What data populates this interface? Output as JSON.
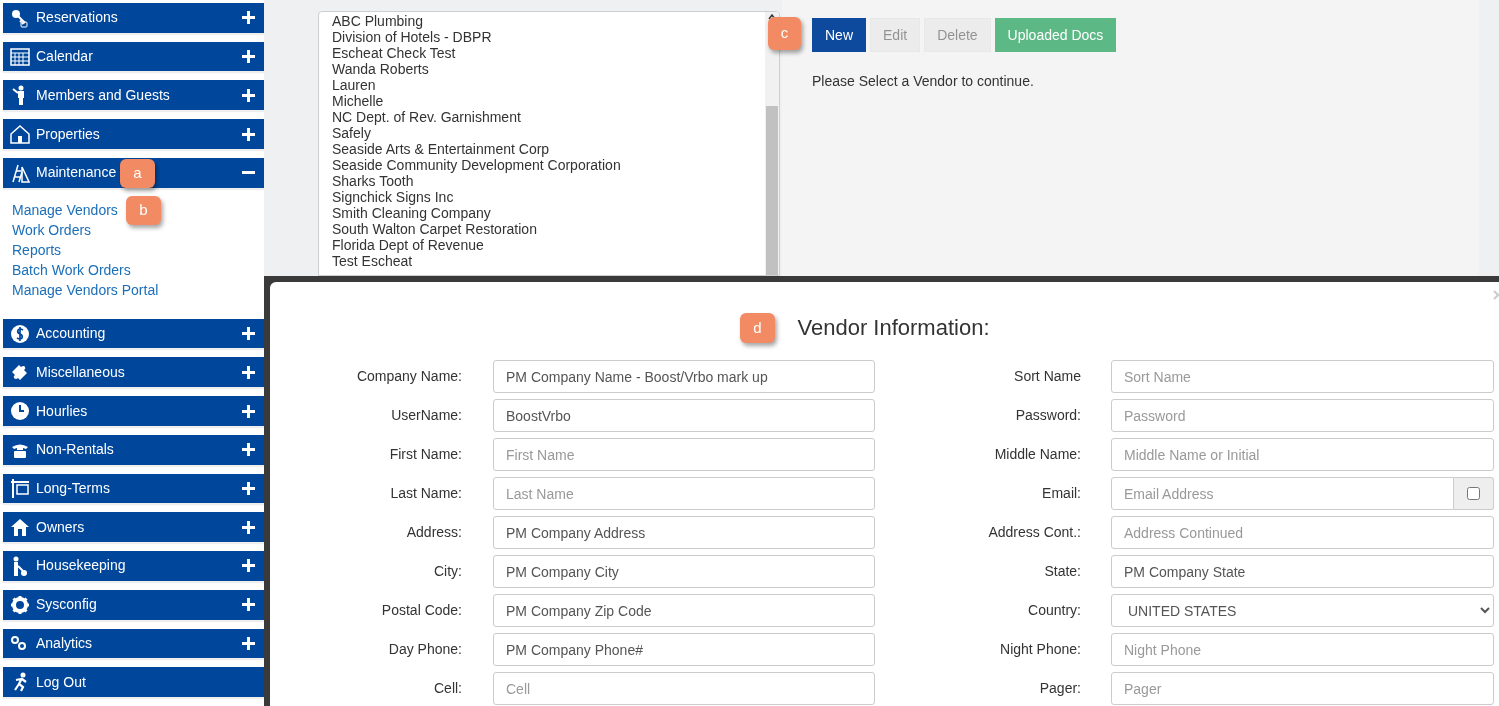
{
  "sidebar": {
    "sections": [
      {
        "label": "Reservations",
        "kind": "section",
        "expanded": false
      },
      {
        "label": "Calendar",
        "kind": "section",
        "expanded": false
      },
      {
        "label": "Members and Guests",
        "kind": "section",
        "expanded": false
      },
      {
        "label": "Properties",
        "kind": "section",
        "expanded": false
      },
      {
        "label": "Maintenance",
        "kind": "section",
        "expanded": true,
        "children": [
          {
            "label": "Manage Vendors"
          },
          {
            "label": "Work Orders"
          },
          {
            "label": "Reports"
          },
          {
            "label": "Batch Work Orders"
          },
          {
            "label": "Manage Vendors Portal"
          }
        ]
      },
      {
        "label": "Accounting",
        "kind": "section",
        "expanded": false
      },
      {
        "label": "Miscellaneous",
        "kind": "section",
        "expanded": false
      },
      {
        "label": "Hourlies",
        "kind": "section",
        "expanded": false
      },
      {
        "label": "Non-Rentals",
        "kind": "section",
        "expanded": false
      },
      {
        "label": "Long-Terms",
        "kind": "section",
        "expanded": false
      },
      {
        "label": "Owners",
        "kind": "section",
        "expanded": false
      },
      {
        "label": "Housekeeping",
        "kind": "section",
        "expanded": false
      },
      {
        "label": "Sysconfig",
        "kind": "section",
        "expanded": false
      },
      {
        "label": "Analytics",
        "kind": "section",
        "expanded": false
      },
      {
        "label": "Log Out",
        "kind": "link"
      }
    ]
  },
  "vendor_list": {
    "items": [
      "ABC Plumbing",
      "Division of Hotels - DBPR",
      "Escheat Check Test",
      "Wanda Roberts",
      "Lauren",
      "Michelle",
      "NC Dept. of Rev. Garnishment",
      "Safely",
      "Seaside Arts & Entertainment Corp",
      "Seaside Community Development Corporation",
      "Sharks Tooth",
      "Signchick Signs Inc",
      "Smith Cleaning Company",
      "South Walton Carpet Restoration",
      "Florida Dept of Revenue",
      "Test Escheat"
    ]
  },
  "toolbar": [
    {
      "label": "New",
      "kind": "primary",
      "disabled": false
    },
    {
      "label": "Edit",
      "kind": "default",
      "disabled": true
    },
    {
      "label": "Delete",
      "kind": "default",
      "disabled": true
    },
    {
      "label": "Uploaded Docs",
      "kind": "success",
      "disabled": false
    }
  ],
  "message": "Please Select a Vendor to continue.",
  "modal": {
    "title": "Vendor Information:",
    "rows": [
      {
        "left": {
          "label": "Company Name:",
          "kind": "text",
          "value": "PM Company Name - Boost/Vrbo mark up"
        },
        "right": {
          "label": "Sort Name",
          "kind": "text",
          "placeholder": "Sort Name"
        }
      },
      {
        "left": {
          "label": "UserName:",
          "kind": "text",
          "value": "BoostVrbo"
        },
        "right": {
          "label": "Password:",
          "kind": "text",
          "placeholder": "Password"
        }
      },
      {
        "left": {
          "label": "First Name:",
          "kind": "text",
          "placeholder": "First Name"
        },
        "right": {
          "label": "Middle Name:",
          "kind": "text",
          "placeholder": "Middle Name or Initial"
        }
      },
      {
        "left": {
          "label": "Last Name:",
          "kind": "text",
          "placeholder": "Last Name"
        },
        "right": {
          "label": "Email:",
          "kind": "text_checkbox",
          "placeholder": "Email Address",
          "checked": false
        }
      },
      {
        "left": {
          "label": "Address:",
          "kind": "text",
          "value": "PM Company Address"
        },
        "right": {
          "label": "Address Cont.:",
          "kind": "text",
          "placeholder": "Address Continued"
        }
      },
      {
        "left": {
          "label": "City:",
          "kind": "text",
          "value": "PM Company City"
        },
        "right": {
          "label": "State:",
          "kind": "text",
          "value": "PM Company State"
        }
      },
      {
        "left": {
          "label": "Postal Code:",
          "kind": "text",
          "value": "PM Company Zip Code"
        },
        "right": {
          "label": "Country:",
          "kind": "select",
          "value": "UNITED STATES"
        }
      },
      {
        "left": {
          "label": "Day Phone:",
          "kind": "text",
          "value": "PM Company Phone#"
        },
        "right": {
          "label": "Night Phone:",
          "kind": "text",
          "placeholder": "Night Phone"
        }
      },
      {
        "left": {
          "label": "Cell:",
          "kind": "text",
          "placeholder": "Cell"
        },
        "right": {
          "label": "Pager:",
          "kind": "text",
          "placeholder": "Pager"
        }
      }
    ]
  },
  "callouts": [
    {
      "label": "a"
    },
    {
      "label": "b"
    },
    {
      "label": "c"
    },
    {
      "label": "d"
    }
  ]
}
